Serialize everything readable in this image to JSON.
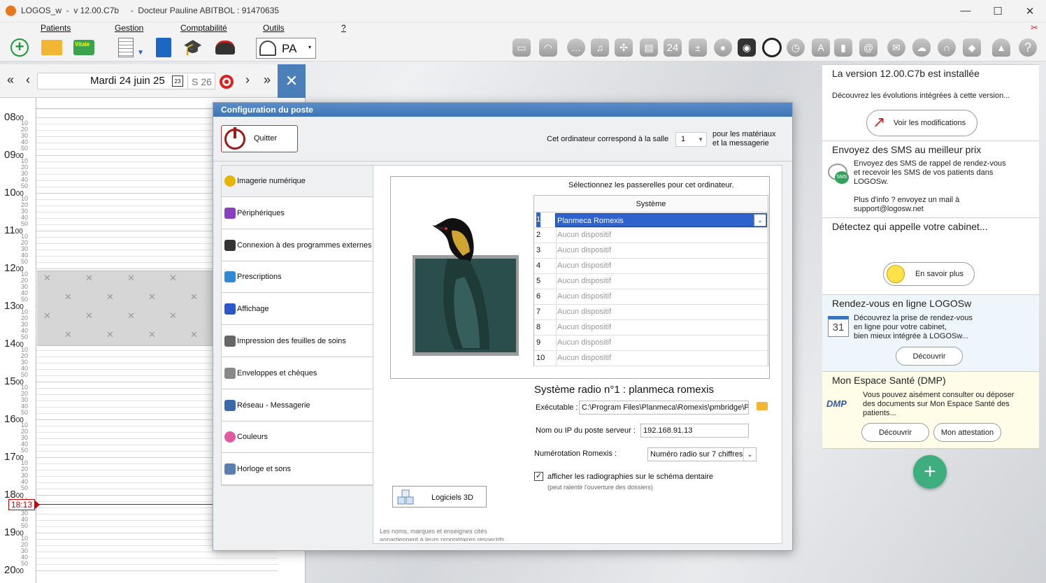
{
  "window": {
    "title": "LOGOS_w  -  v 12.00.C7b     -  Docteur Pauline ABITBOL : 91470635"
  },
  "menu": [
    "Patients",
    "Gestion",
    "Comptabilité",
    "Outils",
    "?"
  ],
  "toolbar": {
    "user_initials": "PA",
    "calendar_day": "24"
  },
  "calendar": {
    "date": "Mardi 24 juin 25",
    "week": "S 26",
    "hours": [
      "08",
      "09",
      "10",
      "11",
      "12",
      "13",
      "14",
      "15",
      "16",
      "17",
      "18",
      "19",
      "20"
    ],
    "hour_suffix": "00",
    "minute_marks": [
      "10",
      "20",
      "30",
      "40",
      "50"
    ],
    "current_time": "18:13"
  },
  "right_panel": {
    "version": {
      "title": "La version 12.00.C7b est installée",
      "text": "Découvrez les évolutions intégrées à cette version...",
      "button": "Voir les modifications"
    },
    "sms": {
      "title": "Envoyez des SMS au meilleur prix",
      "text": "Envoyez des SMS de rappel de rendez-vous\net recevoir les SMS de vos patients dans\nLOGOSw.",
      "text2": "Plus d'info ? envoyez un mail à\nsupport@logosw.net",
      "icon_label": "SMS"
    },
    "caller": {
      "title": "Détectez qui appelle votre cabinet...",
      "button": "En savoir plus"
    },
    "rdv": {
      "title": "Rendez-vous en ligne LOGOSw",
      "text": "Découvrez la prise de rendez-vous\nen ligne pour votre cabinet,\nbien mieux intégrée à LOGOSw...",
      "button": "Découvrir",
      "icon_label": "31"
    },
    "sante": {
      "title": "Mon Espace Santé (DMP)",
      "text": "Vous pouvez aisément consulter ou déposer\ndes documents sur Mon Espace Santé des\npatients...",
      "button1": "Découvrir",
      "button2": "Mon attestation",
      "logo": "DMP"
    }
  },
  "dialog": {
    "title": "Configuration du poste",
    "quit": "Quitter",
    "salle_label": "Cet ordinateur correspond à la salle",
    "salle_value": "1",
    "salle_note": "pour les matériaux\net la messagerie",
    "nav": [
      "Imagerie numérique",
      "Périphériques",
      "Connexion à des programmes externes",
      "Prescriptions",
      "Affichage",
      "Impression des feuilles de soins",
      "Enveloppes et chèques",
      "Réseau - Messagerie",
      "Couleurs",
      "Horloge et sons"
    ],
    "select_hint": "Sélectionnez les passerelles pour cet ordinateur.",
    "table_header": "Système",
    "rows": [
      {
        "n": "1",
        "device": "Planmeca Romexis"
      },
      {
        "n": "2",
        "device": "Aucun dispositif"
      },
      {
        "n": "3",
        "device": "Aucun dispositif"
      },
      {
        "n": "4",
        "device": "Aucun dispositif"
      },
      {
        "n": "5",
        "device": "Aucun dispositif"
      },
      {
        "n": "6",
        "device": "Aucun dispositif"
      },
      {
        "n": "7",
        "device": "Aucun dispositif"
      },
      {
        "n": "8",
        "device": "Aucun dispositif"
      },
      {
        "n": "9",
        "device": "Aucun dispositif"
      },
      {
        "n": "10",
        "device": "Aucun dispositif"
      }
    ],
    "system_title": "Système radio n°1 : planmeca romexis",
    "exe_label": "Exécutable :",
    "exe_value": "C:\\Program Files\\Planmeca\\Romexis\\pmbridge\\Pro",
    "server_label": "Nom ou IP du poste serveur :",
    "server_value": "192.168.91.13",
    "numbering_label": "Numérotation Romexis :",
    "numbering_value": "Numéro radio sur 7 chiffres",
    "checkbox_label": "afficher les radiographies sur le schéma dentaire",
    "checkbox_checked": true,
    "checkbox_note": "(peut ralentir l'ouverture des dossiers)",
    "btn3d": "Logiciels 3D",
    "footer": "Les noms, marques et enseignes cités\nappartiennent à leurs propriétaires respectifs"
  }
}
